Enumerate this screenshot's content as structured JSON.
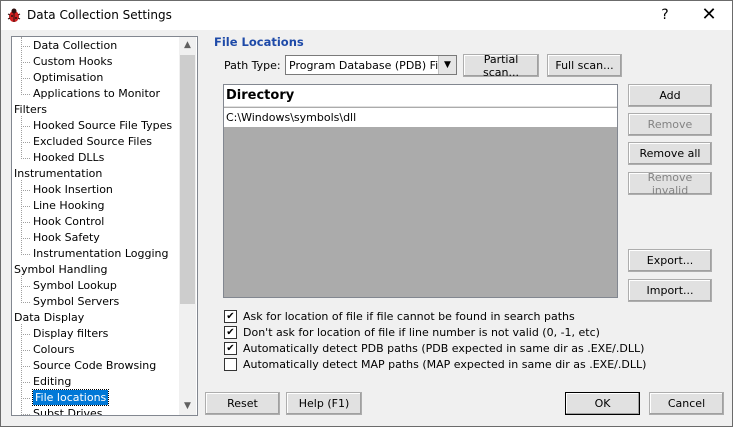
{
  "window": {
    "title": "Data Collection Settings",
    "help": "?",
    "close": "✕"
  },
  "tree": {
    "items": [
      {
        "label": "Data Collection",
        "level": 1
      },
      {
        "label": "Custom Hooks",
        "level": 1
      },
      {
        "label": "Optimisation",
        "level": 1
      },
      {
        "label": "Applications to Monitor",
        "level": 1
      },
      {
        "label": "Filters",
        "level": 0
      },
      {
        "label": "Hooked Source File Types",
        "level": 1
      },
      {
        "label": "Excluded Source Files",
        "level": 1
      },
      {
        "label": "Hooked DLLs",
        "level": 1
      },
      {
        "label": "Instrumentation",
        "level": 0
      },
      {
        "label": "Hook Insertion",
        "level": 1
      },
      {
        "label": "Line Hooking",
        "level": 1
      },
      {
        "label": "Hook Control",
        "level": 1
      },
      {
        "label": "Hook Safety",
        "level": 1
      },
      {
        "label": "Instrumentation Logging",
        "level": 1
      },
      {
        "label": "Symbol Handling",
        "level": 0
      },
      {
        "label": "Symbol Lookup",
        "level": 1
      },
      {
        "label": "Symbol Servers",
        "level": 1
      },
      {
        "label": "Data Display",
        "level": 0
      },
      {
        "label": "Display filters",
        "level": 1
      },
      {
        "label": "Colours",
        "level": 1
      },
      {
        "label": "Source Code Browsing",
        "level": 1
      },
      {
        "label": "Editing",
        "level": 1
      },
      {
        "label": "File locations",
        "level": 1,
        "selected": true
      },
      {
        "label": "Subst Drives",
        "level": 1
      }
    ]
  },
  "panel": {
    "title": "File Locations",
    "path_type_label": "Path Type:",
    "path_type_value": "Program Database (PDB) Files",
    "partial_scan": "Partial scan...",
    "full_scan": "Full scan...",
    "list_header": "Directory",
    "list_rows": [
      "C:\\Windows\\symbols\\dll"
    ],
    "add": "Add",
    "remove": "Remove",
    "remove_all": "Remove all",
    "remove_invalid": "Remove invalid",
    "export": "Export...",
    "import": "Import...",
    "checkboxes": [
      {
        "label": "Ask for location of file if file cannot be found in search paths",
        "checked": true
      },
      {
        "label": "Don't ask for location of file if line number is not valid (0, -1, etc)",
        "checked": true
      },
      {
        "label": "Automatically detect PDB paths (PDB expected in same dir as .EXE/.DLL)",
        "checked": true
      },
      {
        "label": "Automatically detect MAP paths (MAP expected in same dir as .EXE/.DLL)",
        "checked": false
      }
    ]
  },
  "footer": {
    "reset": "Reset",
    "help": "Help (F1)",
    "ok": "OK",
    "cancel": "Cancel"
  },
  "colors": {
    "selection": "#0078d7",
    "section_title": "#1e4aa8",
    "list_empty": "#ababab"
  }
}
